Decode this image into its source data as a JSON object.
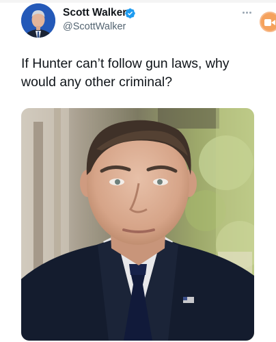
{
  "tweet": {
    "author": {
      "display_name": "Scott Walker",
      "handle": "@ScottWalker",
      "verified": true,
      "avatar": "avatar-photo"
    },
    "text": "If Hunter can’t follow gun laws, why would any other criminal?",
    "media": {
      "type": "photo",
      "icon": "photo-man-in-suit"
    },
    "menu_icon": "more-options-icon"
  },
  "colors": {
    "text": "#0f1419",
    "secondary_text": "#536471",
    "verified_blue": "#1d9bf0",
    "badge_orange": "#f5a25d"
  }
}
